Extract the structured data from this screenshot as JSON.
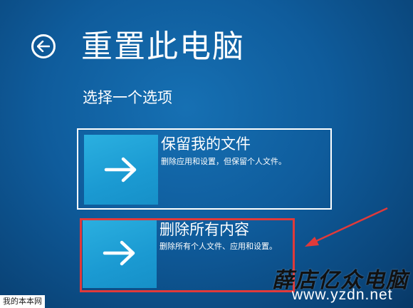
{
  "header": {
    "back_icon": "arrow-left-circle-icon",
    "title": "重置此电脑"
  },
  "prompt": "选择一个选项",
  "options": [
    {
      "title": "保留我的文件",
      "description": "删除应用和设置，但保留个人文件。",
      "icon": "arrow-right-icon",
      "selected": true
    },
    {
      "title": "删除所有内容",
      "description": "删除所有个人文件、应用和设置。",
      "icon": "arrow-right-icon",
      "selected": false
    }
  ],
  "annotation": {
    "highlight_color": "#e03a3a"
  },
  "watermark": {
    "brand": "薛店亿众电脑",
    "url": "www.yzdn.net",
    "corner": "我的本本网"
  },
  "colors": {
    "background": "#0f5c9c",
    "tile": "#1b9ad2",
    "text": "#ffffff"
  }
}
